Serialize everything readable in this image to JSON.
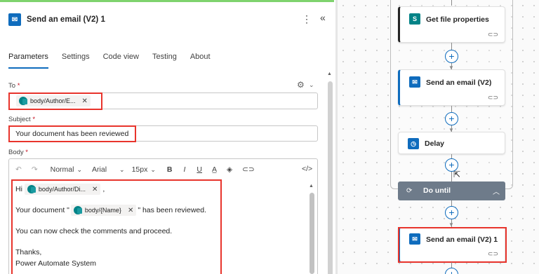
{
  "panel": {
    "title": "Send an email (V2) 1",
    "app_icon": "outlook-icon",
    "more_icon": "⋮",
    "collapse_icon": "«",
    "tabs": [
      "Parameters",
      "Settings",
      "Code view",
      "Testing",
      "About"
    ],
    "active_tab": "Parameters",
    "to": {
      "label": "To",
      "required_mark": "*",
      "token": "body/Author/E...",
      "token_remove": "✕"
    },
    "subject": {
      "label": "Subject",
      "required_mark": "*",
      "value": "Your document has been reviewed"
    },
    "body": {
      "label": "Body",
      "required_mark": "*",
      "toolbar": {
        "undo": "↶",
        "redo": "↷",
        "format": "Normal",
        "font": "Arial",
        "size": "15px",
        "bold": "B",
        "italic": "I",
        "underline": "U",
        "code": "</>"
      },
      "line1_prefix": "Hi",
      "line1_token": "body/Author/Di...",
      "line1_suffix": ",",
      "line2_prefix": "Your document \"",
      "line2_token": "body/{Name}",
      "line2_suffix": "\" has been reviewed.",
      "line3": "You can now check the comments and proceed.",
      "line4": "Thanks,",
      "line5": "Power Automate System"
    },
    "highlight_color": "#e8342c",
    "accent_color": "#0f6cbd"
  },
  "canvas": {
    "cards": [
      {
        "title": "Get file properties",
        "icon": "sharepoint-icon",
        "color": "#038387"
      },
      {
        "title": "Send an email (V2)",
        "icon": "outlook-icon",
        "color": "#0f6cbd"
      },
      {
        "title": "Delay",
        "icon": "timer-icon",
        "color": "#0f6cbd"
      },
      {
        "title": "Send an email (V2) 1",
        "icon": "outlook-icon",
        "color": "#0f6cbd"
      }
    ],
    "do_until": {
      "title": "Do until",
      "color": "#6e7b8a"
    },
    "plus_label": "+"
  }
}
